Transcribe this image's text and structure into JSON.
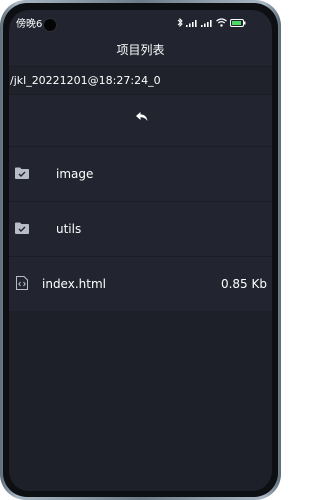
{
  "status_bar": {
    "time": "傍晚6:",
    "icons": [
      "bluetooth-icon",
      "signal-icon",
      "signal-icon",
      "wifi-icon",
      "battery-icon"
    ]
  },
  "header": {
    "title": "项目列表"
  },
  "path": "/jkl_20221201@18:27:24_0",
  "list": {
    "back_icon": "back-arrow-icon",
    "items": [
      {
        "type": "folder",
        "name": "image",
        "icon": "folder-check-icon"
      },
      {
        "type": "folder",
        "name": "utils",
        "icon": "folder-check-icon"
      },
      {
        "type": "file",
        "name": "index.html",
        "size": "0.85 Kb",
        "icon": "html-file-icon"
      }
    ]
  },
  "colors": {
    "background": "#222530",
    "divider": "#1b1d25",
    "text": "#ffffff",
    "icon_gray": "#b8bcc6"
  }
}
